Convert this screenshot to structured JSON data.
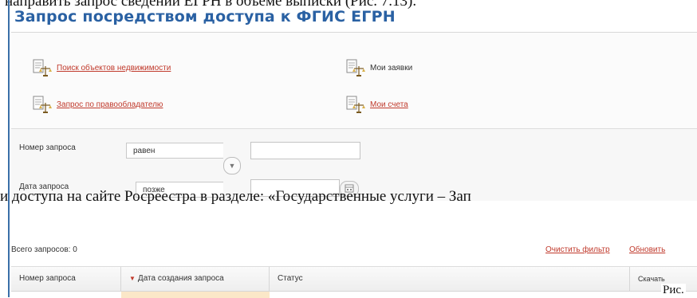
{
  "document": {
    "top_text": "направить запрос сведений ЕГРН в объеме выписки (Рис. 7.13).",
    "overlay_text": "и доступа на сайте Росреестра в разделе: «Государственные услуги – Зап",
    "figure_label": "Рис."
  },
  "page": {
    "title": "Запрос посредством доступа к ФГИС ЕГРН"
  },
  "nav": {
    "items": [
      {
        "label": "Поиск объектов недвижимости",
        "icon": "document-scales-icon"
      },
      {
        "label": "Мои заявки",
        "icon": "document-scales-icon"
      },
      {
        "label": "Запрос по правообладателю",
        "icon": "document-scales-icon"
      },
      {
        "label": "Мои счета",
        "icon": "document-scales-icon"
      }
    ]
  },
  "filters": {
    "request_number": {
      "label": "Номер запроса",
      "operator": "равен",
      "value": ""
    },
    "request_date": {
      "label": "Дата запроса",
      "operator": "позже",
      "value": ""
    }
  },
  "grid": {
    "total_label": "Всего запросов: 0",
    "clear_filter_label": "Очистить фильтр",
    "refresh_label": "Обновить",
    "columns": [
      "Номер запроса",
      "Дата создания запроса",
      "Статус",
      "Скачать"
    ]
  },
  "colors": {
    "title_blue": "#2a61a3",
    "link_red": "#c0392b"
  }
}
